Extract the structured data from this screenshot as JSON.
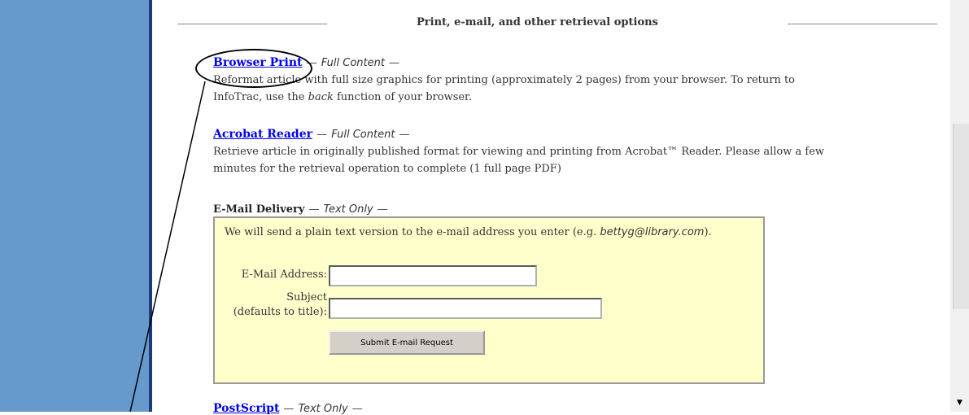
{
  "heading": "Print, e-mail, and other retrieval options",
  "options": [
    {
      "link": "Browser Print",
      "note": "Full Content",
      "desc_line1": "Reformat article with full size graphics for printing (approximately 2 pages) from your browser. To return to",
      "desc_line2_pre": "InfoTrac, use the ",
      "desc_line2_em": "back",
      "desc_line2_post": " function of your browser."
    },
    {
      "link": "Acrobat Reader",
      "note": "Full Content",
      "desc_line1": "Retrieve article in originally published format for viewing and printing from Acrobat™ Reader. Please allow a few",
      "desc_line2": "minutes for the retrieval operation to complete (1 full page PDF)"
    }
  ],
  "email": {
    "title": "E-Mail Delivery",
    "note": "Text Only",
    "intro_pre": "We will send a plain text version to the e-mail address you enter (e.g. ",
    "intro_example": "bettyg@library.com",
    "intro_post": ").",
    "address_label": "E-Mail Address:",
    "subject_label_1": "Subject",
    "subject_label_2": "(defaults to title):",
    "address_value": "",
    "subject_value": "",
    "submit_label": "Submit E-mail Request"
  },
  "postscript": {
    "link": "PostScript",
    "note": "Text Only"
  },
  "dash": "—"
}
